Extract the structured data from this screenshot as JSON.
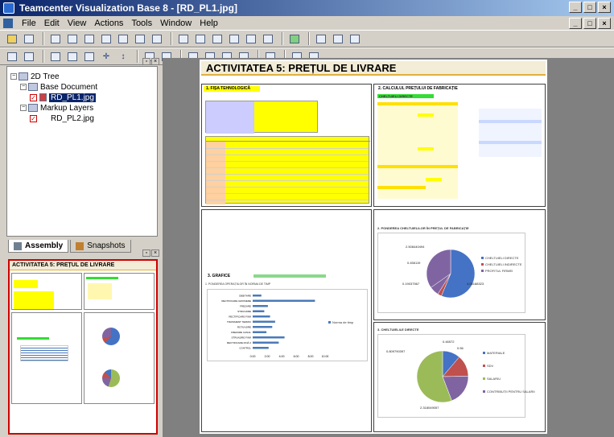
{
  "window": {
    "title": "Teamcenter Visualization Base 8 - [RD_PL1.jpg]",
    "controls": [
      "_",
      "□",
      "×"
    ]
  },
  "menu": [
    "File",
    "Edit",
    "View",
    "Actions",
    "Tools",
    "Window",
    "Help"
  ],
  "tree": {
    "root": "2D Tree",
    "base_document": "Base Document",
    "selected_file": "RD_PL1.jpg",
    "markup_layers": "Markup Layers",
    "markup_file": "RD_PL2.jpg"
  },
  "tabs": [
    "Assembly",
    "Snapshots"
  ],
  "document": {
    "title": "ACTIVITATEA 5:  PREȚUL DE LIVRARE",
    "thumb_title": "ACTIVITATEA 5:  PREȚUL DE LIVRARE",
    "sec1": "1. FIȘA TEHNOLOGICĂ",
    "sec2": "2. CALCULUL PREȚULUI DE FABRICAȚIE",
    "sec3": "3. GRAFICE",
    "sec3_sub": "1. PONDEREA OPERAȚIILOR ÎN NORMA DE TIMP",
    "sec4": "2. PONDEREA CHELTUIELILOR ÎN PREȚUL DE FABRICAȚIE",
    "sec5": "3. CHELTUIELILE DIRECTE",
    "calc_label": "CHELTUIELI DIRECTE",
    "pie1_labels": [
      "2.508440494",
      "0.456119",
      "0.19037567",
      "4.06188323"
    ],
    "pie1_legend": [
      "CHELTUIELI DIRECTE",
      "CHELTUIELI INDIRECTE",
      "PROFITUL FIRMEI"
    ],
    "pie2_labels": [
      "0.46572",
      "0.56",
      "0.809790397",
      "2.318049057"
    ],
    "pie2_legend": [
      "MATERIALE",
      "SDV",
      "SALARIU",
      "CONTRIBUȚII PENTRU SALARII"
    ],
    "bar_axis": [
      "0.00",
      "2.00",
      "4.00",
      "6.00",
      "8.00",
      "10.00"
    ],
    "bar_legend": "Norma de timp",
    "ops": [
      "DEBITARE",
      "RECTIFICARE GROSIERE",
      "FREZARE",
      "STRUNJIRE",
      "RECTIFICARE FINĂ",
      "TRATAMENT TERMIC",
      "ROTUNJIRE",
      "FREZARE CANAL",
      "STRUNJIRE FINĂ",
      "RECTIFICARE FINĂ 2",
      "CONTROL"
    ]
  },
  "colors": {
    "pie_blue": "#4472c4",
    "pie_red": "#c0504d",
    "pie_purple": "#8064a2",
    "pie_green": "#9bbb59",
    "title_accent": "#e0b040",
    "highlight": "#ffff00"
  }
}
